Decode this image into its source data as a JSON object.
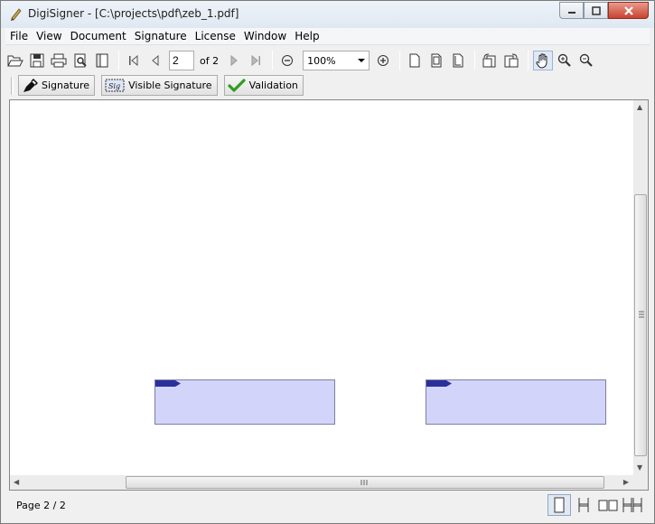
{
  "window": {
    "title": "DigiSigner - [C:\\projects\\pdf\\zeb_1.pdf]"
  },
  "menu": [
    "File",
    "View",
    "Document",
    "Signature",
    "License",
    "Window",
    "Help"
  ],
  "toolbar": {
    "page_value": "2",
    "page_total": "of 2",
    "zoom_value": "100%",
    "icons": [
      "open-icon",
      "save-icon",
      "print-icon",
      "print-preview-icon",
      "properties-icon",
      "first-page-icon",
      "previous-page-icon",
      "next-page-icon",
      "last-page-icon",
      "zoom-out-icon",
      "zoom-in-icon",
      "single-page-icon",
      "fit-width-icon",
      "fit-page-icon",
      "rotate-left-icon",
      "rotate-right-icon",
      "hand-tool-icon",
      "zoom-in-tool-icon",
      "zoom-out-tool-icon"
    ]
  },
  "signature_toolbar": {
    "signature_label": "Signature",
    "visible_signature_label": "Visible Signature",
    "validation_label": "Validation"
  },
  "document": {
    "signature_field_color": "#d2d4fa",
    "signature_tag_color": "#2b2f9c"
  },
  "status": {
    "page_label": "Page 2 / 2"
  }
}
